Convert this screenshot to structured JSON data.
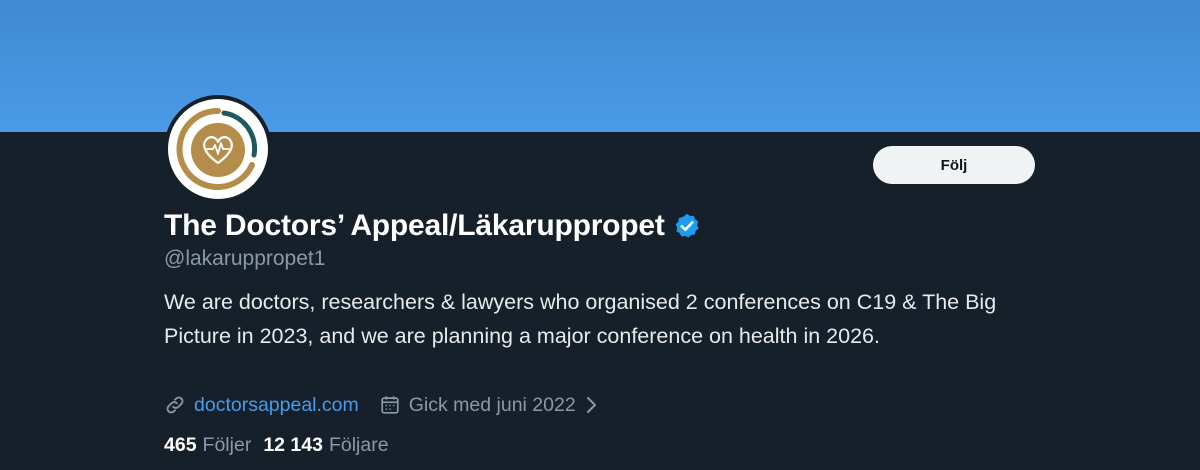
{
  "profile": {
    "display_name": "The Doctors’ Appeal/Läkaruppropet",
    "handle": "@lakaruppropet1",
    "bio": "We are doctors, researchers & lawyers who organised 2 conferences on C19 & The Big Picture in 2023, and we are planning a major conference on health in 2026.",
    "verified_icon": "verified-badge-icon",
    "website": "doctorsappeal.com",
    "joined": "Gick med juni 2022"
  },
  "actions": {
    "follow_label": "Följ"
  },
  "stats": {
    "following_count": "465",
    "following_label": "Följer",
    "followers_count": "12 143",
    "followers_label": "Följare"
  },
  "icons": {
    "link": "link-icon",
    "calendar": "calendar-icon",
    "chevron": "chevron-right-icon",
    "avatar_logo": "heart-pulse-logo-icon"
  },
  "colors": {
    "background": "#15202b",
    "banner": "#4a9ae6",
    "accent_link": "#4a9bea",
    "verified": "#1d9bf0",
    "secondary_text": "#8b98a5",
    "logo_gold": "#b58d4a",
    "logo_teal": "#1f5a5c"
  }
}
